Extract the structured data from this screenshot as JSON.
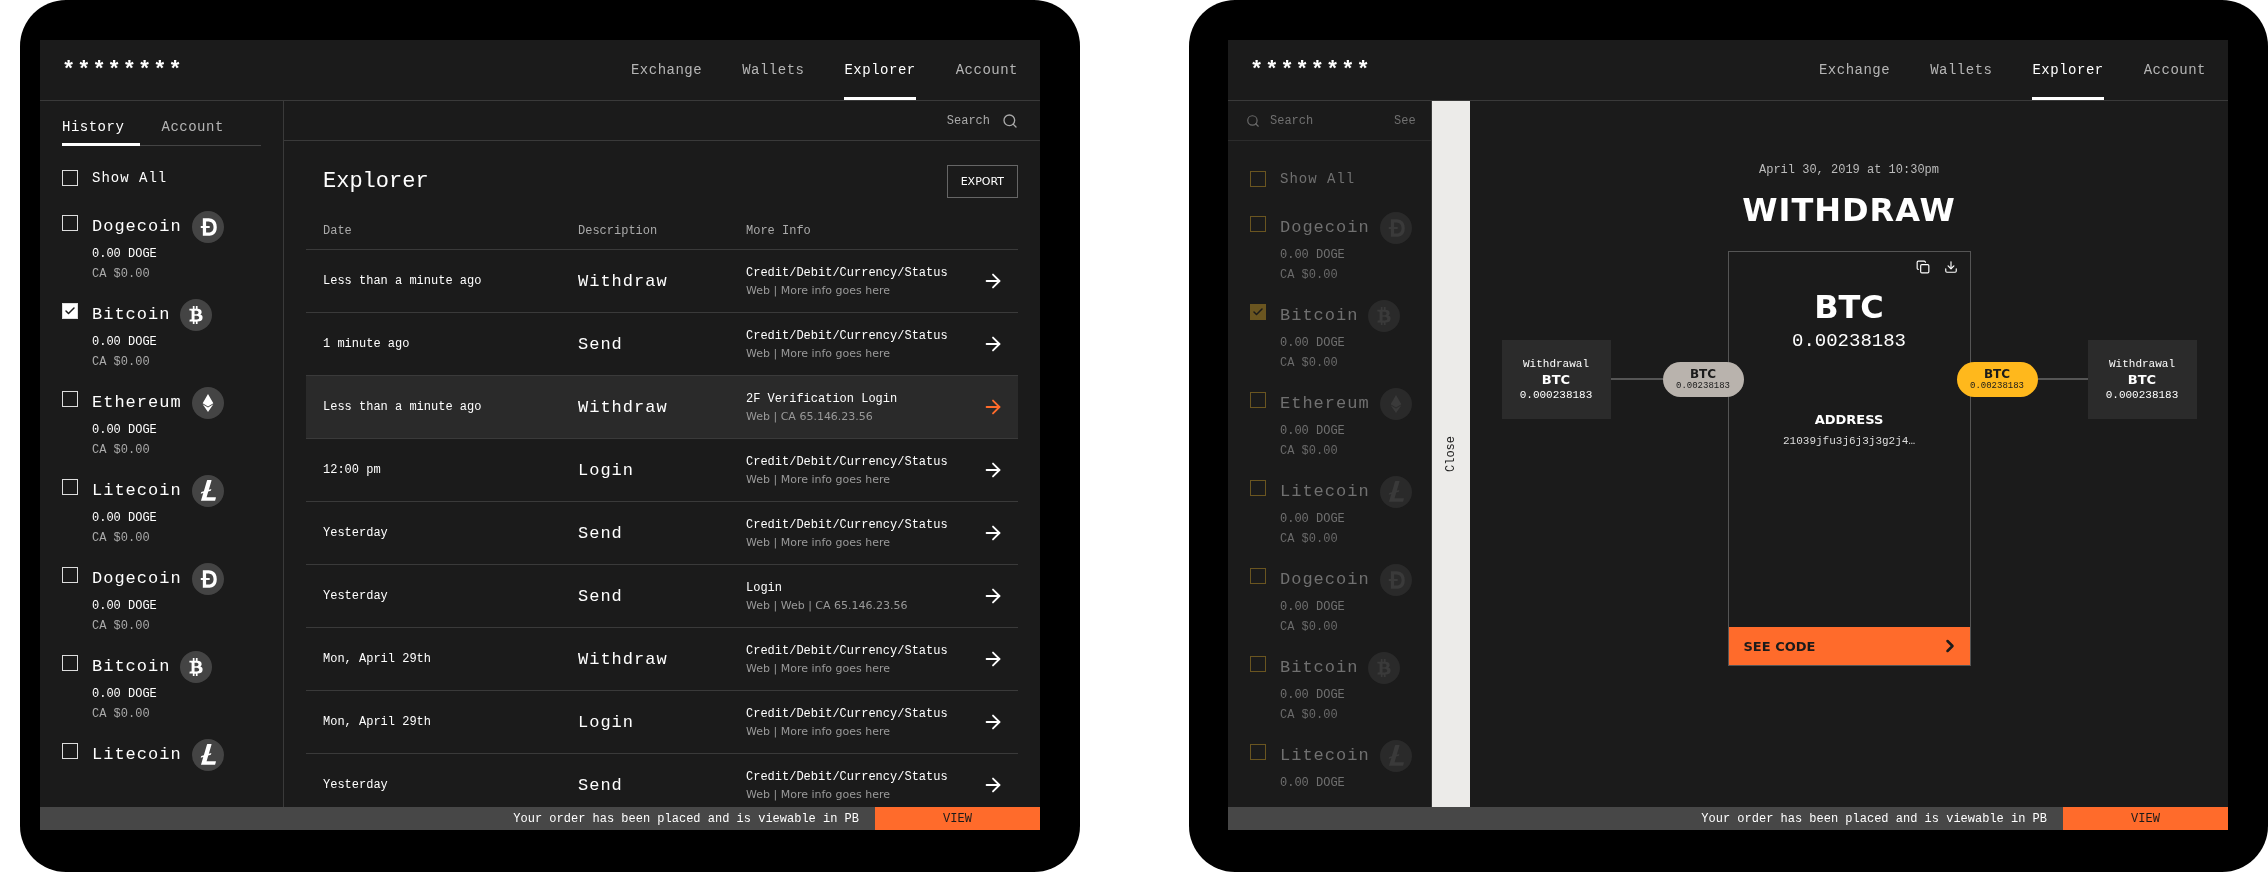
{
  "screens": [
    {
      "kind": "list",
      "logo": "********",
      "nav": [
        {
          "label": "Exchange",
          "selected": false
        },
        {
          "label": "Wallets",
          "selected": false
        },
        {
          "label": "Explorer",
          "selected": true
        },
        {
          "label": "Account",
          "selected": false
        }
      ],
      "sidebar": {
        "tabs": [
          {
            "label": "History",
            "selected": true
          },
          {
            "label": "Account",
            "selected": false
          }
        ],
        "show_all": {
          "label": "Show All",
          "checked": false
        },
        "items": [
          {
            "label": "Dogecoin",
            "kind": "doge",
            "checked": false,
            "amount": "0.00 DOGE",
            "fiat": "CA $0.00"
          },
          {
            "label": "Bitcoin",
            "kind": "btc",
            "checked": true,
            "amount": "0.00 DOGE",
            "fiat": "CA $0.00"
          },
          {
            "label": "Ethereum",
            "kind": "eth",
            "checked": false,
            "amount": "0.00 DOGE",
            "fiat": "CA $0.00"
          },
          {
            "label": "Litecoin",
            "kind": "ltc",
            "checked": false,
            "amount": "0.00 DOGE",
            "fiat": "CA $0.00"
          },
          {
            "label": "Dogecoin",
            "kind": "doge",
            "checked": false,
            "amount": "0.00 DOGE",
            "fiat": "CA $0.00"
          },
          {
            "label": "Bitcoin",
            "kind": "btc",
            "checked": false,
            "amount": "0.00 DOGE",
            "fiat": "CA $0.00"
          },
          {
            "label": "Litecoin",
            "kind": "ltc",
            "checked": false
          }
        ]
      },
      "search": {
        "placeholder": "Search"
      },
      "title": "Explorer",
      "export": "EXPORT",
      "table": {
        "columns": [
          "Date",
          "Description",
          "More Info"
        ],
        "rows": [
          {
            "date": "Less than a minute ago",
            "description": "Withdraw",
            "info": "Credit/Debit/Currency/Status",
            "detail": "Web | More info goes here",
            "selected": false
          },
          {
            "date": "1 minute ago",
            "description": "Send",
            "info": "Credit/Debit/Currency/Status",
            "detail": "Web | More info goes here",
            "selected": false
          },
          {
            "date": "Less than a minute ago",
            "description": "Withdraw",
            "info": "2F Verification Login",
            "detail": "Web | CA 65.146.23.56",
            "selected": true
          },
          {
            "date": "12:00 pm",
            "description": "Login",
            "info": "Credit/Debit/Currency/Status",
            "detail": "Web | More info goes here",
            "selected": false
          },
          {
            "date": "Yesterday",
            "description": "Send",
            "info": "Credit/Debit/Currency/Status",
            "detail": "Web | More info goes here",
            "selected": false
          },
          {
            "date": "Yesterday",
            "description": "Send",
            "info": "Login",
            "detail": "Web | Web | CA 65.146.23.56",
            "selected": false
          },
          {
            "date": "Mon, April 29th",
            "description": "Withdraw",
            "info": "Credit/Debit/Currency/Status",
            "detail": "Web | More info goes here",
            "selected": false
          },
          {
            "date": "Mon, April 29th",
            "description": "Login",
            "info": "Credit/Debit/Currency/Status",
            "detail": "Web | More info goes here",
            "selected": false
          },
          {
            "date": "Yesterday",
            "description": "Send",
            "info": "Credit/Debit/Currency/Status",
            "detail": "Web | More info goes here",
            "selected": false
          }
        ]
      },
      "notice": {
        "text": "Your order has been placed and is viewable in PB",
        "action": "VIEW"
      }
    },
    {
      "kind": "detail",
      "logo": "********",
      "nav": [
        {
          "label": "Exchange",
          "selected": false
        },
        {
          "label": "Wallets",
          "selected": false
        },
        {
          "label": "Explorer",
          "selected": true
        },
        {
          "label": "Account",
          "selected": false
        }
      ],
      "sidebar": {
        "search": {
          "placeholder": "Search"
        },
        "search_action": "See",
        "show_all": {
          "label": "Show All",
          "checked": false
        },
        "items": [
          {
            "label": "Dogecoin",
            "kind": "doge",
            "checked": false,
            "amount": "0.00 DOGE",
            "fiat": "CA $0.00"
          },
          {
            "label": "Bitcoin",
            "kind": "btc",
            "checked": true,
            "amount": "0.00 DOGE",
            "fiat": "CA $0.00"
          },
          {
            "label": "Ethereum",
            "kind": "eth",
            "checked": false,
            "amount": "0.00 DOGE",
            "fiat": "CA $0.00"
          },
          {
            "label": "Litecoin",
            "kind": "ltc",
            "checked": false,
            "amount": "0.00 DOGE",
            "fiat": "CA $0.00"
          },
          {
            "label": "Dogecoin",
            "kind": "doge",
            "checked": false,
            "amount": "0.00 DOGE",
            "fiat": "CA $0.00"
          },
          {
            "label": "Bitcoin",
            "kind": "btc",
            "checked": false,
            "amount": "0.00 DOGE",
            "fiat": "CA $0.00"
          },
          {
            "label": "Litecoin",
            "kind": "ltc",
            "checked": false,
            "amount": "0.00 DOGE"
          }
        ]
      },
      "close": "Close",
      "detail": {
        "date": "April 30, 2019 at 10:30pm",
        "title": "WITHDRAW",
        "from": {
          "label": "Withdrawal",
          "currency": "BTC",
          "amount": "0.000238183"
        },
        "from_pill": {
          "currency": "BTC",
          "amount": "0.00238183",
          "color": "#b9b3ad"
        },
        "card": {
          "currency": "BTC",
          "amount": "0.00238183",
          "address_label": "ADDRESS",
          "address": "21039jfu3j6j3j3g2j4…",
          "button": "SEE CODE"
        },
        "to_pill": {
          "currency": "BTC",
          "amount": "0.00238183",
          "color": "#ffb81c"
        },
        "to": {
          "label": "Withdrawal",
          "currency": "BTC",
          "amount": "0.000238183"
        }
      },
      "notice": {
        "text": "Your order has been placed and is viewable in PB",
        "action": "VIEW"
      }
    }
  ]
}
